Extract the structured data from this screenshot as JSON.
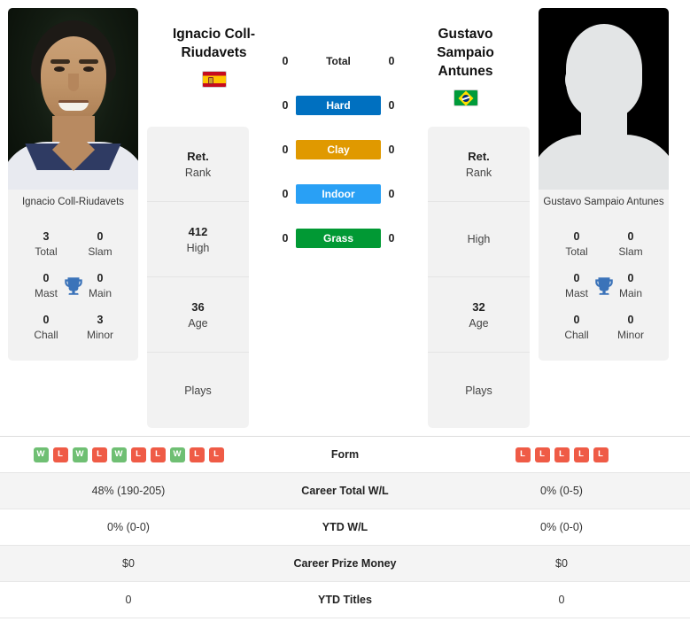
{
  "players": {
    "left": {
      "name": "Ignacio Coll-Riudavets",
      "name_heading_lines": [
        "Ignacio Coll-",
        "Riudavets"
      ],
      "country": "Spain",
      "flag_icon": "flag-spain",
      "photo_type": "portrait-photo",
      "titles": [
        {
          "num": "3",
          "label": "Total"
        },
        {
          "num": "0",
          "label": "Slam"
        },
        {
          "num": "0",
          "label": "Mast"
        },
        {
          "num": "0",
          "label": "Main"
        },
        {
          "num": "0",
          "label": "Chall"
        },
        {
          "num": "3",
          "label": "Minor"
        }
      ],
      "info": [
        {
          "val": "Ret.",
          "key": "Rank"
        },
        {
          "val": "412",
          "key": "High"
        },
        {
          "val": "36",
          "key": "Age"
        },
        {
          "val": "",
          "key": "Plays"
        }
      ],
      "form": [
        "W",
        "L",
        "W",
        "L",
        "W",
        "L",
        "L",
        "W",
        "L",
        "L"
      ],
      "career_total_wl": "48% (190-205)",
      "ytd_wl": "0% (0-0)",
      "career_prize_money": "$0",
      "ytd_titles": "0",
      "surface_scores": {
        "total": "0",
        "hard": "0",
        "clay": "0",
        "indoor": "0",
        "grass": "0"
      }
    },
    "right": {
      "name": "Gustavo Sampaio Antunes",
      "name_heading_lines": [
        "Gustavo",
        "Sampaio",
        "Antunes"
      ],
      "country": "Brazil",
      "flag_icon": "flag-brazil",
      "photo_type": "silhouette-placeholder",
      "titles": [
        {
          "num": "0",
          "label": "Total"
        },
        {
          "num": "0",
          "label": "Slam"
        },
        {
          "num": "0",
          "label": "Mast"
        },
        {
          "num": "0",
          "label": "Main"
        },
        {
          "num": "0",
          "label": "Chall"
        },
        {
          "num": "0",
          "label": "Minor"
        }
      ],
      "info": [
        {
          "val": "Ret.",
          "key": "Rank"
        },
        {
          "val": "",
          "key": "High"
        },
        {
          "val": "32",
          "key": "Age"
        },
        {
          "val": "",
          "key": "Plays"
        }
      ],
      "form": [
        "L",
        "L",
        "L",
        "L",
        "L"
      ],
      "career_total_wl": "0% (0-5)",
      "ytd_wl": "0% (0-0)",
      "career_prize_money": "$0",
      "ytd_titles": "0",
      "surface_scores": {
        "total": "0",
        "hard": "0",
        "clay": "0",
        "indoor": "0",
        "grass": "0"
      }
    }
  },
  "surfaces": [
    {
      "key": "total",
      "label": "Total",
      "color": "transparent",
      "text_color": "#222222"
    },
    {
      "key": "hard",
      "label": "Hard",
      "color": "#0070c0",
      "text_color": "#ffffff"
    },
    {
      "key": "clay",
      "label": "Clay",
      "color": "#e09900",
      "text_color": "#ffffff"
    },
    {
      "key": "indoor",
      "label": "Indoor",
      "color": "#29a0f5",
      "text_color": "#ffffff"
    },
    {
      "key": "grass",
      "label": "Grass",
      "color": "#019934",
      "text_color": "#ffffff"
    }
  ],
  "table": {
    "rows": [
      {
        "label": "Form",
        "left": "",
        "right": "",
        "type": "form",
        "shaded": false
      },
      {
        "label": "Career Total W/L",
        "left": "48% (190-205)",
        "right": "0% (0-5)",
        "type": "text",
        "shaded": true
      },
      {
        "label": "YTD W/L",
        "left": "0% (0-0)",
        "right": "0% (0-0)",
        "type": "text",
        "shaded": false
      },
      {
        "label": "Career Prize Money",
        "left": "$0",
        "right": "$0",
        "type": "text",
        "shaded": true
      },
      {
        "label": "YTD Titles",
        "left": "0",
        "right": "0",
        "type": "text",
        "shaded": false
      }
    ]
  },
  "icons": {
    "trophy": "trophy-icon"
  },
  "colors": {
    "win_badge": "#6fbf73",
    "loss_badge": "#ef5b46",
    "card_bg": "#f2f2f2",
    "row_shade": "#f4f4f4"
  }
}
